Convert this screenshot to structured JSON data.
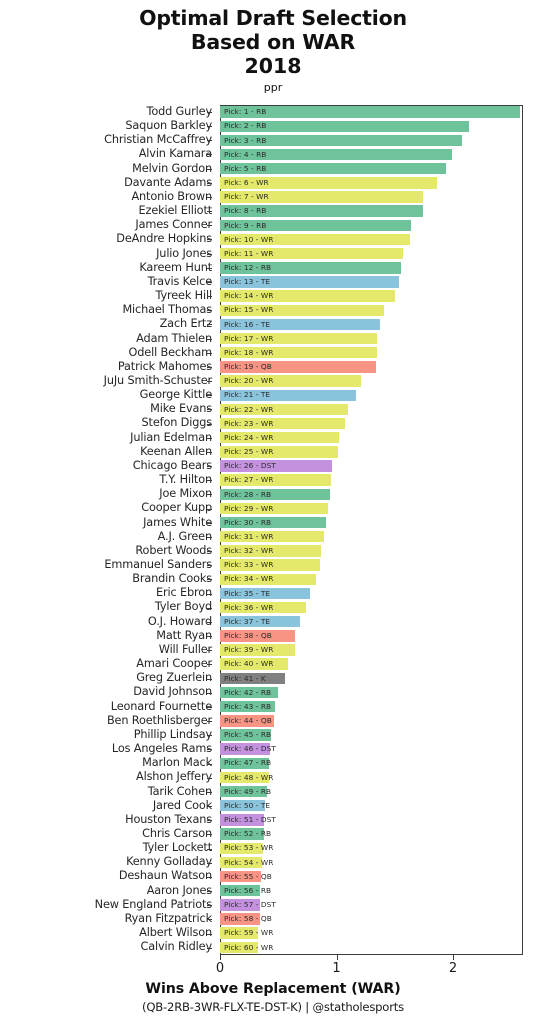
{
  "title": {
    "line1": "Optimal Draft Selection",
    "line2": "Based on WAR",
    "year": "2018",
    "subtitle": "ppr"
  },
  "axis": {
    "x_title": "Wins Above Replacement (WAR)",
    "x_ticks": [
      "0",
      "1",
      "2"
    ],
    "x_tick_values": [
      0,
      1,
      2
    ],
    "xlim": [
      0,
      2.6
    ]
  },
  "footer": "(QB-2RB-3WR-FLX-TE-DST-K) | @statholesports",
  "colors": {
    "RB": "#6FC39B",
    "WR": "#E4E86B",
    "TE": "#8AC4DC",
    "QB": "#F79484",
    "DST": "#C391DE",
    "K": "#808080",
    "axis": "#3d3d3d",
    "text": "#262626"
  },
  "chart_data": {
    "type": "bar",
    "orientation": "horizontal",
    "title": "Optimal Draft Selection Based on WAR 2018",
    "subtitle": "ppr",
    "xlabel": "Wins Above Replacement (WAR)",
    "ylabel": "",
    "xlim": [
      0,
      2.6
    ],
    "grid": false,
    "legend": "none",
    "categories": [
      "Todd Gurley",
      "Saquon Barkley",
      "Christian McCaffrey",
      "Alvin Kamara",
      "Melvin Gordon",
      "Davante Adams",
      "Antonio Brown",
      "Ezekiel Elliott",
      "James Conner",
      "DeAndre Hopkins",
      "Julio Jones",
      "Kareem Hunt",
      "Travis Kelce",
      "Tyreek Hill",
      "Michael Thomas",
      "Zach Ertz",
      "Adam Thielen",
      "Odell Beckham",
      "Patrick Mahomes",
      "JuJu Smith-Schuster",
      "George Kittle",
      "Mike Evans",
      "Stefon Diggs",
      "Julian Edelman",
      "Keenan Allen",
      "Chicago Bears",
      "T.Y. Hilton",
      "Joe Mixon",
      "Cooper Kupp",
      "James White",
      "A.J. Green",
      "Robert Woods",
      "Emmanuel Sanders",
      "Brandin Cooks",
      "Eric Ebron",
      "Tyler Boyd",
      "O.J. Howard",
      "Matt Ryan",
      "Will Fuller",
      "Amari Cooper",
      "Greg Zuerlein",
      "David Johnson",
      "Leonard Fournette",
      "Ben Roethlisberger",
      "Phillip Lindsay",
      "Los Angeles Rams",
      "Marlon Mack",
      "Alshon Jeffery",
      "Tarik Cohen",
      "Jared Cook",
      "Houston Texans",
      "Chris Carson",
      "Tyler Lockett",
      "Kenny Golladay",
      "Deshaun Watson",
      "Aaron Jones",
      "New England Patriots",
      "Ryan Fitzpatrick",
      "Albert Wilson",
      "Calvin Ridley"
    ],
    "values": [
      2.57,
      2.14,
      2.08,
      1.99,
      1.94,
      1.86,
      1.74,
      1.74,
      1.64,
      1.63,
      1.57,
      1.55,
      1.54,
      1.5,
      1.41,
      1.37,
      1.35,
      1.35,
      1.34,
      1.21,
      1.17,
      1.1,
      1.07,
      1.02,
      1.01,
      0.96,
      0.95,
      0.94,
      0.93,
      0.91,
      0.89,
      0.87,
      0.86,
      0.82,
      0.77,
      0.74,
      0.69,
      0.64,
      0.64,
      0.58,
      0.56,
      0.5,
      0.47,
      0.46,
      0.44,
      0.43,
      0.42,
      0.42,
      0.4,
      0.39,
      0.38,
      0.38,
      0.37,
      0.36,
      0.35,
      0.34,
      0.34,
      0.34,
      0.33,
      0.33
    ],
    "positions": [
      "RB",
      "RB",
      "RB",
      "RB",
      "RB",
      "WR",
      "WR",
      "RB",
      "RB",
      "WR",
      "WR",
      "RB",
      "TE",
      "WR",
      "WR",
      "TE",
      "WR",
      "WR",
      "QB",
      "WR",
      "TE",
      "WR",
      "WR",
      "WR",
      "WR",
      "DST",
      "WR",
      "RB",
      "WR",
      "RB",
      "WR",
      "WR",
      "WR",
      "WR",
      "TE",
      "WR",
      "TE",
      "QB",
      "WR",
      "WR",
      "K",
      "RB",
      "RB",
      "QB",
      "RB",
      "DST",
      "RB",
      "WR",
      "RB",
      "TE",
      "DST",
      "RB",
      "WR",
      "WR",
      "QB",
      "RB",
      "DST",
      "QB",
      "WR",
      "WR"
    ],
    "bar_labels": [
      "Pick: 1 - RB",
      "Pick: 2 - RB",
      "Pick: 3 - RB",
      "Pick: 4 - RB",
      "Pick: 5 - RB",
      "Pick: 6 - WR",
      "Pick: 7 - WR",
      "Pick: 8 - RB",
      "Pick: 9 - RB",
      "Pick: 10 - WR",
      "Pick: 11 - WR",
      "Pick: 12 - RB",
      "Pick: 13 - TE",
      "Pick: 14 - WR",
      "Pick: 15 - WR",
      "Pick: 16 - TE",
      "Pick: 17 - WR",
      "Pick: 18 - WR",
      "Pick: 19 - QB",
      "Pick: 20 - WR",
      "Pick: 21 - TE",
      "Pick: 22 - WR",
      "Pick: 23 - WR",
      "Pick: 24 - WR",
      "Pick: 25 - WR",
      "Pick: 26 - DST",
      "Pick: 27 - WR",
      "Pick: 28 - RB",
      "Pick: 29 - WR",
      "Pick: 30 - RB",
      "Pick: 31 - WR",
      "Pick: 32 - WR",
      "Pick: 33 - WR",
      "Pick: 34 - WR",
      "Pick: 35 - TE",
      "Pick: 36 - WR",
      "Pick: 37 - TE",
      "Pick: 38 - QB",
      "Pick: 39 - WR",
      "Pick: 40 - WR",
      "Pick: 41 - K",
      "Pick: 42 - RB",
      "Pick: 43 - RB",
      "Pick: 44 - QB",
      "Pick: 45 - RB",
      "Pick: 46 - DST",
      "Pick: 47 - RB",
      "Pick: 48 - WR",
      "Pick: 49 - RB",
      "Pick: 50 - TE",
      "Pick: 51 - DST",
      "Pick: 52 - RB",
      "Pick: 53 - WR",
      "Pick: 54 - WR",
      "Pick: 55 - QB",
      "Pick: 56 - RB",
      "Pick: 57 - DST",
      "Pick: 58 - QB",
      "Pick: 59 - WR",
      "Pick: 60 - WR"
    ]
  }
}
